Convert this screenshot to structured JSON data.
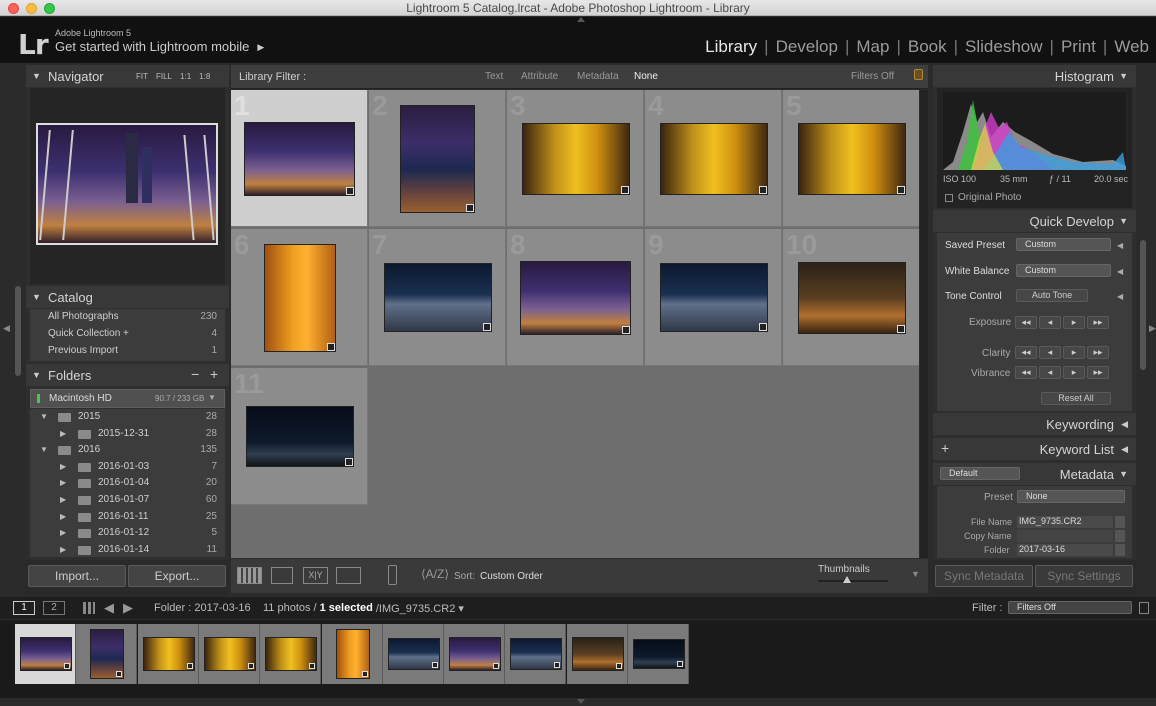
{
  "window": {
    "title": "Lightroom 5 Catalog.lrcat - Adobe Photoshop Lightroom - Library"
  },
  "identity": {
    "logo": "Lr",
    "product": "Adobe Lightroom 5",
    "mobile": "Get started with Lightroom mobile",
    "mobile_arrow": "▶"
  },
  "modules": [
    "Library",
    "Develop",
    "Map",
    "Book",
    "Slideshow",
    "Print",
    "Web"
  ],
  "active_module": "Library",
  "navigator": {
    "title": "Navigator",
    "zoom": [
      "FIT",
      "FILL",
      "1:1",
      "1:8"
    ]
  },
  "catalog": {
    "title": "Catalog",
    "items": [
      {
        "label": "All Photographs",
        "count": "230"
      },
      {
        "label": "Quick Collection +",
        "count": "4"
      },
      {
        "label": "Previous Import",
        "count": "1"
      }
    ]
  },
  "folders": {
    "title": "Folders",
    "add": "+",
    "remove": "−",
    "volume": {
      "name": "Macintosh HD",
      "space": "90.7 / 233 GB"
    },
    "items": [
      {
        "label": "2015",
        "count": "28",
        "level": 0,
        "expanded": true
      },
      {
        "label": "2015-12-31",
        "count": "28",
        "level": 1,
        "expanded": false
      },
      {
        "label": "2016",
        "count": "135",
        "level": 0,
        "expanded": true
      },
      {
        "label": "2016-01-03",
        "count": "7",
        "level": 1,
        "expanded": false
      },
      {
        "label": "2016-01-04",
        "count": "20",
        "level": 1,
        "expanded": false
      },
      {
        "label": "2016-01-07",
        "count": "60",
        "level": 1,
        "expanded": false
      },
      {
        "label": "2016-01-11",
        "count": "25",
        "level": 1,
        "expanded": false
      },
      {
        "label": "2016-01-12",
        "count": "5",
        "level": 1,
        "expanded": false
      },
      {
        "label": "2016-01-14",
        "count": "11",
        "level": 1,
        "expanded": false
      }
    ]
  },
  "left_buttons": {
    "import": "Import...",
    "export": "Export..."
  },
  "filterbar": {
    "label": "Library Filter :",
    "options": [
      "Text",
      "Attribute",
      "Metadata",
      "None"
    ],
    "active": "None",
    "filters": "Filters Off"
  },
  "grid": {
    "cells": [
      {
        "n": "1",
        "style": "city"
      },
      {
        "n": "2",
        "style": "tower"
      },
      {
        "n": "3",
        "style": "gold"
      },
      {
        "n": "4",
        "style": "gold"
      },
      {
        "n": "5",
        "style": "gold"
      },
      {
        "n": "6",
        "style": "orange"
      },
      {
        "n": "7",
        "style": "night"
      },
      {
        "n": "8",
        "style": "city"
      },
      {
        "n": "9",
        "style": "night"
      },
      {
        "n": "10",
        "style": "sunset"
      },
      {
        "n": "11",
        "style": "dark"
      }
    ]
  },
  "toolbar": {
    "sort_label": "Sort:",
    "sort_value": "Custom Order",
    "thumbnails": "Thumbnails"
  },
  "histogram": {
    "title": "Histogram",
    "iso": "ISO 100",
    "focal": "35 mm",
    "aperture": "ƒ / 11",
    "shutter": "20.0 sec",
    "original": "Original Photo"
  },
  "quick_develop": {
    "title": "Quick Develop",
    "saved_preset_label": "Saved Preset",
    "saved_preset": "Custom",
    "wb_label": "White Balance",
    "wb": "Custom",
    "tone_label": "Tone Control",
    "auto_tone": "Auto Tone",
    "exposure": "Exposure",
    "clarity": "Clarity",
    "vibrance": "Vibrance",
    "reset": "Reset All"
  },
  "keywording": {
    "title": "Keywording"
  },
  "keyword_list": {
    "title": "Keyword List",
    "add": "+"
  },
  "metadata": {
    "title": "Metadata",
    "set": "Default",
    "preset_label": "Preset",
    "preset": "None",
    "file_name_label": "File Name",
    "file_name": "IMG_9735.CR2",
    "copy_name_label": "Copy Name",
    "copy_name": "",
    "folder_label": "Folder",
    "folder": "2017-03-16"
  },
  "right_buttons": {
    "sync_metadata": "Sync Metadata",
    "sync_settings": "Sync Settings"
  },
  "filmstrip_bar": {
    "page1": "1",
    "page2": "2",
    "folder": "Folder : 2017-03-16",
    "count": "11 photos /",
    "selected": "1 selected",
    "file": "/IMG_9735.CR2 ▾",
    "filter_label": "Filter :",
    "filter_value": "Filters Off"
  },
  "filmstrip": [
    "city",
    "tower",
    "gold",
    "gold",
    "gold",
    "orange",
    "night",
    "city",
    "night",
    "sunset",
    "dark"
  ]
}
